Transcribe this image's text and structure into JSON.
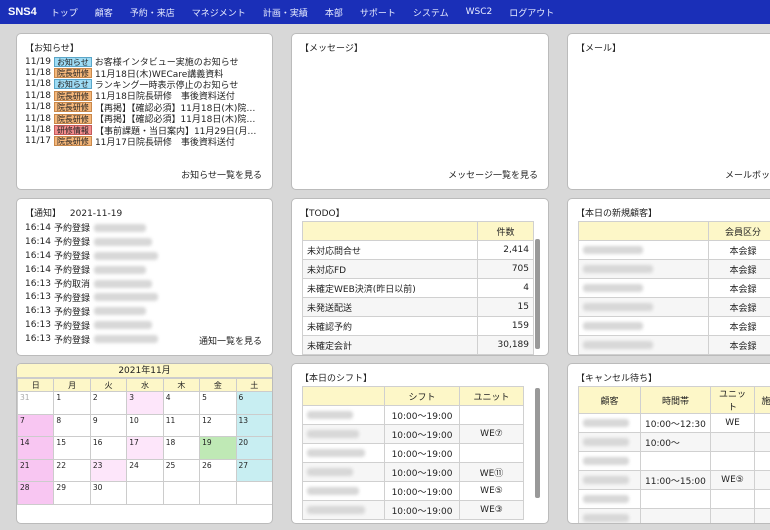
{
  "nav": {
    "logo": "SNS4",
    "items": [
      "トップ",
      "顧客",
      "予約・来店",
      "マネジメント",
      "計画・実績",
      "本部",
      "サポート",
      "システム",
      "WSC2",
      "ログアウト"
    ]
  },
  "notice": {
    "title": "【お知らせ】",
    "more": "お知らせ一覧を見る",
    "rows": [
      {
        "date": "11/19",
        "tag": "お知らせ",
        "tag_color": "blue",
        "text": "お客様インタビュー実施のお知らせ"
      },
      {
        "date": "11/18",
        "tag": "院長研修",
        "tag_color": "orange",
        "text": "11月18日(木)WECare講義資料"
      },
      {
        "date": "11/18",
        "tag": "お知らせ",
        "tag_color": "blue",
        "text": "ランキング一時表示停止のお知らせ"
      },
      {
        "date": "11/18",
        "tag": "院長研修",
        "tag_color": "orange",
        "text": "11月18日院長研修　事後資料送付"
      },
      {
        "date": "11/18",
        "tag": "院長研修",
        "tag_color": "orange",
        "text": "【再掲】【確認必須】11月18日(木)院…"
      },
      {
        "date": "11/18",
        "tag": "院長研修",
        "tag_color": "orange",
        "text": "【再掲】【確認必須】11月18日(木)院…"
      },
      {
        "date": "11/18",
        "tag": "研修情報",
        "tag_color": "red",
        "text": "【事前課題・当日案内】11月29日(月…"
      },
      {
        "date": "11/17",
        "tag": "院長研修",
        "tag_color": "orange",
        "text": "11月17日院長研修　事後資料送付"
      }
    ]
  },
  "message": {
    "title": "【メッセージ】",
    "more": "メッセージ一覧を見る"
  },
  "mail": {
    "title": "【メール】",
    "more": "メールボッ"
  },
  "alerts": {
    "title": "【通知】",
    "date": "2021-11-19",
    "more": "通知一覧を見る",
    "rows": [
      {
        "time": "16:14",
        "type": "予約登録"
      },
      {
        "time": "16:14",
        "type": "予約登録"
      },
      {
        "time": "16:14",
        "type": "予約登録"
      },
      {
        "time": "16:14",
        "type": "予約登録"
      },
      {
        "time": "16:13",
        "type": "予約取消"
      },
      {
        "time": "16:13",
        "type": "予約登録"
      },
      {
        "time": "16:13",
        "type": "予約登録"
      },
      {
        "time": "16:13",
        "type": "予約登録"
      },
      {
        "time": "16:13",
        "type": "予約登録"
      }
    ]
  },
  "todo": {
    "title": "【TODO】",
    "header": "件数",
    "rows": [
      {
        "label": "未対応問合せ",
        "count": "2,414"
      },
      {
        "label": "未対応FD",
        "count": "705"
      },
      {
        "label": "未確定WEB決済(昨日以前)",
        "count": "4"
      },
      {
        "label": "未発送配送",
        "count": "15"
      },
      {
        "label": "未確認予約",
        "count": "159"
      },
      {
        "label": "未確定会計",
        "count": "30,189"
      }
    ]
  },
  "newcust": {
    "title": "【本日の新規顧客】",
    "header": "会員区分",
    "rows": [
      "本会録",
      "本会録",
      "本会録",
      "本会録",
      "本会録",
      "本会録"
    ]
  },
  "calendar": {
    "title": "2021年11月",
    "days": [
      "日",
      "月",
      "火",
      "水",
      "木",
      "金",
      "土"
    ],
    "weeks": [
      [
        "31",
        "1",
        "2",
        "3",
        "4",
        "5",
        "6"
      ],
      [
        "7",
        "8",
        "9",
        "10",
        "11",
        "12",
        "13"
      ],
      [
        "14",
        "15",
        "16",
        "17",
        "18",
        "19",
        "20"
      ],
      [
        "21",
        "22",
        "23",
        "24",
        "25",
        "26",
        "27"
      ],
      [
        "28",
        "29",
        "30",
        "",
        "",
        "",
        ""
      ]
    ]
  },
  "shift": {
    "title": "【本日のシフト】",
    "headers": [
      "シフト",
      "ユニット"
    ],
    "rows": [
      {
        "time": "10:00～19:00",
        "unit": ""
      },
      {
        "time": "10:00～19:00",
        "unit": "WE⑦"
      },
      {
        "time": "10:00～19:00",
        "unit": ""
      },
      {
        "time": "10:00～19:00",
        "unit": "WE⑪"
      },
      {
        "time": "10:00～19:00",
        "unit": "WE⑤"
      },
      {
        "time": "10:00～19:00",
        "unit": "WE③"
      }
    ]
  },
  "cancel": {
    "title": "【キャンセル待ち】",
    "headers": [
      "顧客",
      "時間帯",
      "ユニット",
      "施"
    ],
    "rows": [
      {
        "time": "10:00～12:30",
        "unit": "WE"
      },
      {
        "time": "10:00～",
        "unit": ""
      },
      {
        "time": "",
        "unit": ""
      },
      {
        "time": "11:00～15:00",
        "unit": "WE⑤"
      },
      {
        "time": "",
        "unit": ""
      },
      {
        "time": "",
        "unit": ""
      }
    ]
  }
}
